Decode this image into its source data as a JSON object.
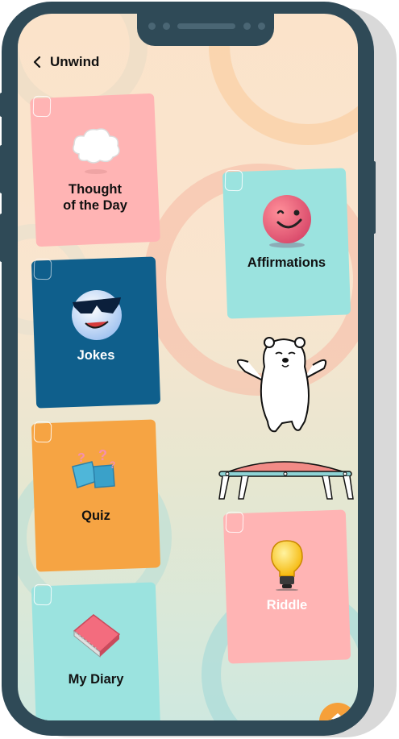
{
  "app": {
    "title": "Unwind"
  },
  "cards": {
    "thought": {
      "label_line1": "Thought",
      "label_line2": "of the Day"
    },
    "affirmations": {
      "label": "Affirmations"
    },
    "jokes": {
      "label": "Jokes"
    },
    "quiz": {
      "label": "Quiz"
    },
    "riddle": {
      "label": "Riddle"
    },
    "diary": {
      "label": "My Diary"
    }
  },
  "colors": {
    "pink": "#ffb4b4",
    "teal": "#9be3df",
    "navy": "#0f5f8c",
    "orange": "#f6a443",
    "phone": "#2f4a57"
  },
  "icons": [
    "back-arrow-icon",
    "cloud-icon",
    "smiley-ball-icon",
    "sunglasses-face-icon",
    "question-boxes-icon",
    "lightbulb-icon",
    "notebook-icon",
    "polar-bear-icon",
    "trampoline-icon",
    "home-icon"
  ]
}
